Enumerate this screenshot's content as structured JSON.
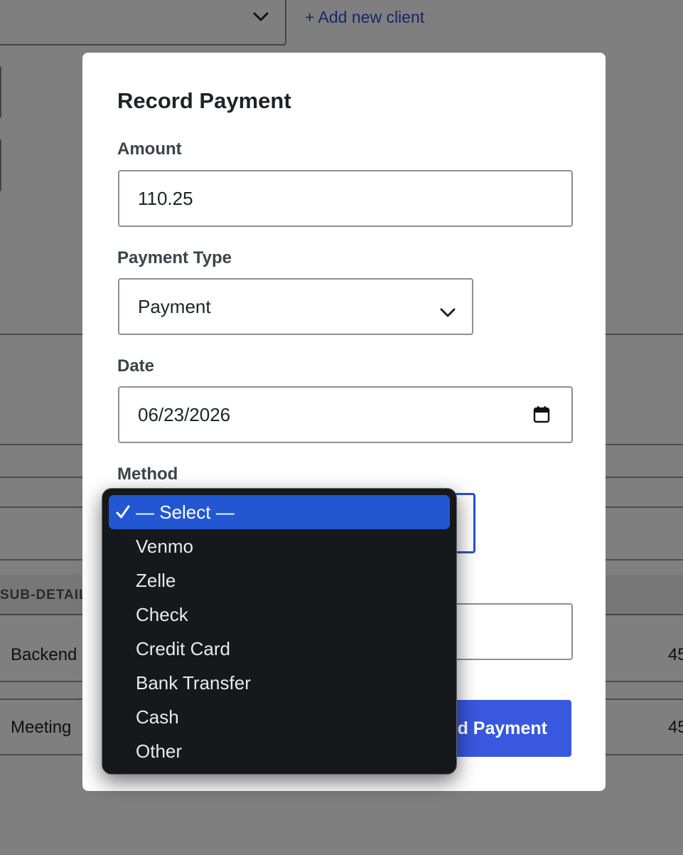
{
  "background": {
    "add_client_link": "+ Add new client",
    "table_header_label": "SUB-DETAIL",
    "rows": [
      {
        "description": "Backend",
        "amount": "45"
      },
      {
        "description": "Meeting",
        "amount": "45"
      }
    ]
  },
  "modal": {
    "title": "Record Payment",
    "amount": {
      "label": "Amount",
      "value": "110.25"
    },
    "payment_type": {
      "label": "Payment Type",
      "selected": "Payment"
    },
    "date": {
      "label": "Date",
      "value": "06/23/2026"
    },
    "method": {
      "label": "Method",
      "options": [
        "— Select —",
        "Venmo",
        "Zelle",
        "Check",
        "Credit Card",
        "Bank Transfer",
        "Cash",
        "Other"
      ],
      "selected_index": 0
    },
    "submit_label": "d Payment"
  },
  "colors": {
    "accent": "#3858e0",
    "focus_ring": "#2a50d6",
    "dropdown_bg": "#17181b",
    "dropdown_highlight": "#2257d1"
  },
  "icons": {
    "chevron": "chevron-down-icon",
    "calendar": "calendar-icon",
    "check": "check-icon"
  }
}
